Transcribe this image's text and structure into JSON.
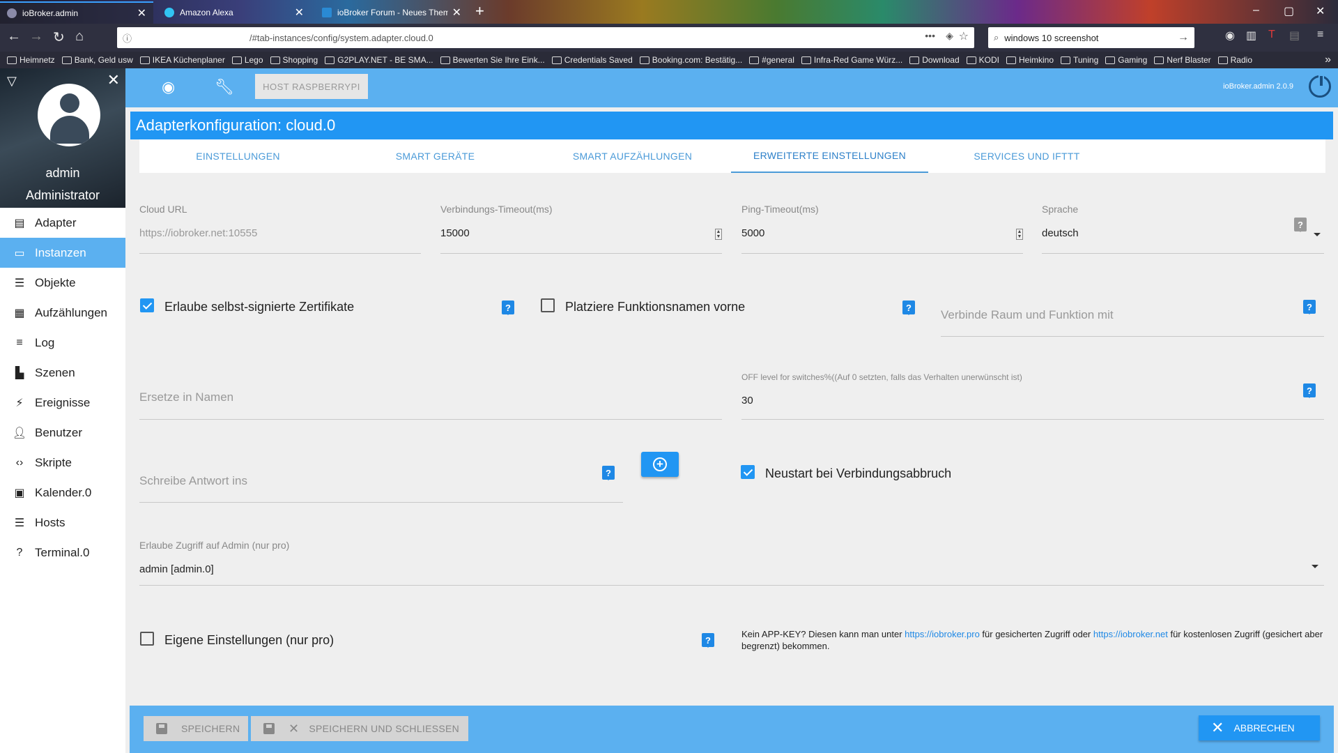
{
  "browser": {
    "tabs": [
      {
        "title": "ioBroker.admin",
        "active": true
      },
      {
        "title": "Amazon Alexa",
        "active": false
      },
      {
        "title": "ioBroker Forum - Neues Thema",
        "active": false
      }
    ],
    "url": "/#tab-instances/config/system.adapter.cloud.0",
    "search": "windows 10 screenshot",
    "bookmarks": [
      "Heimnetz",
      "Bank, Geld usw",
      "IKEA Küchenplaner",
      "Lego",
      "Shopping",
      "G2PLAY.NET - BE SMA...",
      "Bewerten Sie Ihre Eink...",
      "Credentials Saved",
      "Booking.com: Bestätig...",
      "#general",
      "Infra-Red Game Würz...",
      "Download",
      "KODI",
      "Heimkino",
      "Tuning",
      "Gaming",
      "Nerf Blaster",
      "Radio"
    ]
  },
  "sidebar": {
    "user_name": "admin",
    "user_role": "Administrator",
    "items": [
      {
        "label": "Adapter",
        "icon": "store-icon"
      },
      {
        "label": "Instanzen",
        "icon": "instances-icon",
        "active": true
      },
      {
        "label": "Objekte",
        "icon": "list-icon"
      },
      {
        "label": "Aufzählungen",
        "icon": "enum-icon"
      },
      {
        "label": "Log",
        "icon": "log-icon"
      },
      {
        "label": "Szenen",
        "icon": "scenes-icon"
      },
      {
        "label": "Ereignisse",
        "icon": "flash-icon"
      },
      {
        "label": "Benutzer",
        "icon": "user-icon"
      },
      {
        "label": "Skripte",
        "icon": "code-icon"
      },
      {
        "label": "Kalender.0",
        "icon": "calendar-icon"
      },
      {
        "label": "Hosts",
        "icon": "hosts-icon"
      },
      {
        "label": "Terminal.0",
        "icon": "terminal-icon"
      }
    ]
  },
  "appbar": {
    "host_button": "HOST RASPBERRYPI",
    "version": "ioBroker.admin 2.0.9"
  },
  "page_title": "Adapterkonfiguration: cloud.0",
  "tabs": [
    {
      "label": "EINSTELLUNGEN"
    },
    {
      "label": "SMART GERÄTE"
    },
    {
      "label": "SMART AUFZÄHLUNGEN"
    },
    {
      "label": "ERWEITERTE EINSTELLUNGEN",
      "active": true
    },
    {
      "label": "SERVICES UND IFTTT"
    }
  ],
  "form": {
    "cloud_url": {
      "label": "Cloud URL",
      "value": "https://iobroker.net:10555"
    },
    "connection_timeout": {
      "label": "Verbindungs-Timeout(ms)",
      "value": "15000"
    },
    "ping_timeout": {
      "label": "Ping-Timeout(ms)",
      "value": "5000"
    },
    "language": {
      "label": "Sprache",
      "value": "deutsch"
    },
    "self_signed": {
      "label": "Erlaube selbst-signierte Zertifikate",
      "checked": true
    },
    "function_names_first": {
      "label": "Platziere Funktionsnamen vorne",
      "checked": false
    },
    "concat_word": {
      "placeholder": "Verbinde Raum und Funktion mit"
    },
    "replace_in_names": {
      "placeholder": "Ersetze in Namen"
    },
    "off_level": {
      "label": "OFF level for switches%((Auf 0 setzten, falls das Verhalten unerwünscht ist)",
      "value": "30"
    },
    "response_id": {
      "placeholder": "Schreibe Antwort ins"
    },
    "restart_on_disconnect": {
      "label": "Neustart bei Verbindungsabbruch",
      "checked": true
    },
    "allow_admin": {
      "label": "Erlaube Zugriff auf Admin (nur pro)",
      "value": "admin [admin.0]"
    },
    "own_settings": {
      "label": "Eigene Einstellungen (nur pro)",
      "checked": false
    },
    "note": {
      "part1": "Kein APP-KEY? Diesen kann man unter ",
      "link1": "https://iobroker.pro",
      "part2": " für gesicherten Zugriff oder ",
      "link2": "https://iobroker.net",
      "part3": " für kostenlosen Zugriff (gesichert aber begrenzt) bekommen."
    }
  },
  "footer": {
    "save": "SPEICHERN",
    "save_close": "SPEICHERN UND SCHLIESSEN",
    "cancel": "ABBRECHEN"
  },
  "colors": {
    "accent": "#2196f3",
    "appbar": "#5bb0f0"
  }
}
